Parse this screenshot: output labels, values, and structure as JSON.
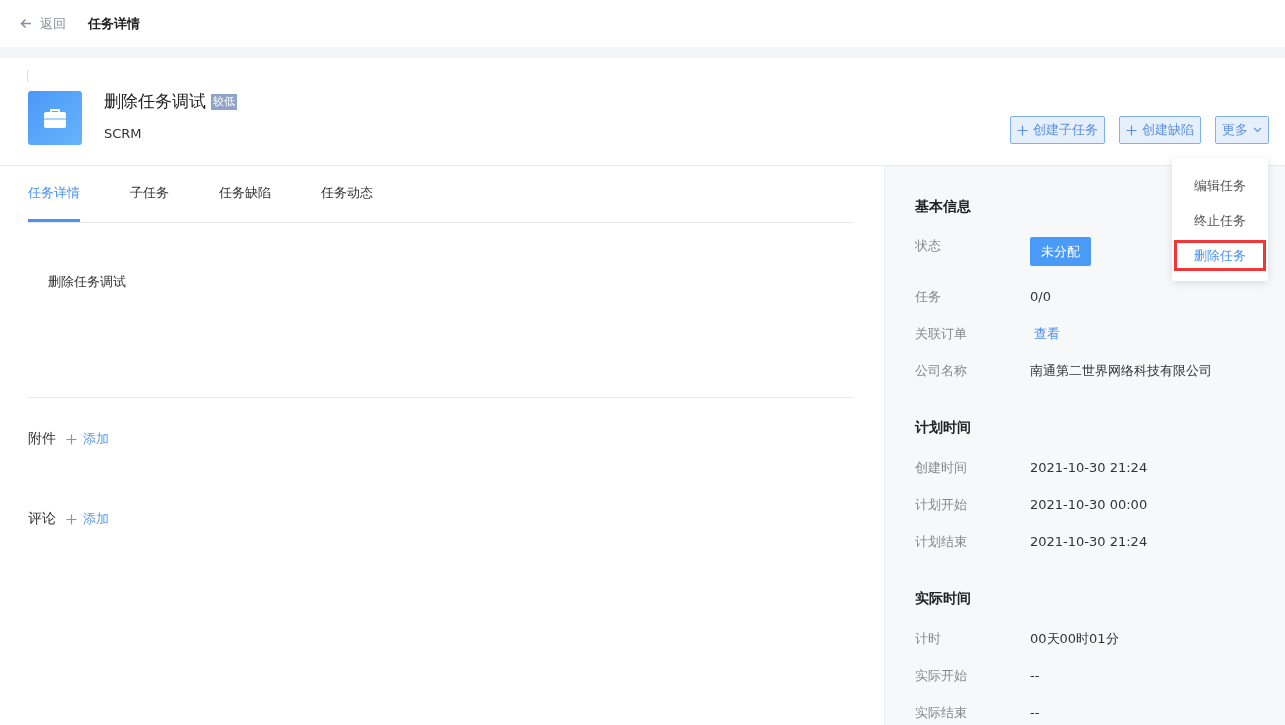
{
  "topbar": {
    "back": "返回",
    "title": "任务详情"
  },
  "task": {
    "title": "删除任务调试",
    "priority": "较低",
    "project": "SCRM"
  },
  "actions": [
    {
      "label": "创建子任务",
      "kind": "add"
    },
    {
      "label": "创建缺陷",
      "kind": "add"
    },
    {
      "label": "更多",
      "kind": "dropdown"
    }
  ],
  "more_menu": [
    {
      "label": "编辑任务",
      "selected": false
    },
    {
      "label": "终止任务",
      "selected": false
    },
    {
      "label": "删除任务",
      "selected": true
    }
  ],
  "tabs": [
    {
      "label": "任务详情",
      "selected": true
    },
    {
      "label": "子任务",
      "selected": false
    },
    {
      "label": "任务缺陷",
      "selected": false
    },
    {
      "label": "任务动态",
      "selected": false
    }
  ],
  "description": "删除任务调试",
  "sections": [
    {
      "label": "附件",
      "action": "添加"
    },
    {
      "label": "评论",
      "action": "添加"
    }
  ],
  "info_groups": [
    {
      "title": "基本信息",
      "rows": [
        {
          "label": "状态",
          "value": "未分配",
          "kind": "badge"
        },
        {
          "label": "任务",
          "value": "0/0",
          "kind": "text"
        },
        {
          "label": "关联订单",
          "value": "查看",
          "kind": "link"
        },
        {
          "label": "公司名称",
          "value": "南通第二世界网络科技有限公司",
          "kind": "text"
        }
      ]
    },
    {
      "title": "计划时间",
      "rows": [
        {
          "label": "创建时间",
          "value": "2021-10-30 21:24",
          "kind": "text"
        },
        {
          "label": "计划开始",
          "value": "2021-10-30 00:00",
          "kind": "text"
        },
        {
          "label": "计划结束",
          "value": "2021-10-30 21:24",
          "kind": "text"
        }
      ]
    },
    {
      "title": "实际时间",
      "rows": [
        {
          "label": "计时",
          "value": "00天00时01分",
          "kind": "text"
        },
        {
          "label": "实际开始",
          "value": "--",
          "kind": "text"
        },
        {
          "label": "实际结束",
          "value": "--",
          "kind": "text"
        }
      ]
    }
  ]
}
